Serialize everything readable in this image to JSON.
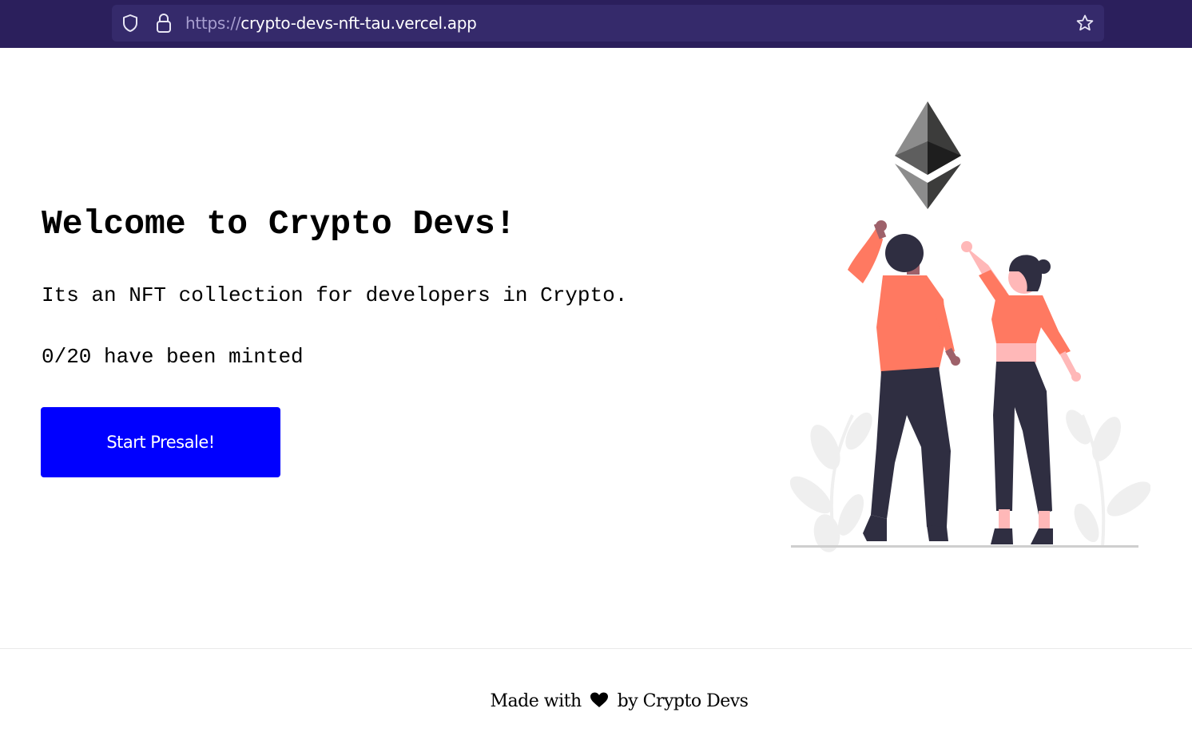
{
  "browser": {
    "url_protocol": "https://",
    "url_host": "crypto-devs-nft-tau.vercel.app",
    "icons": [
      "shield-icon",
      "lock-icon",
      "star-icon"
    ]
  },
  "hero": {
    "title": "Welcome to Crypto Devs!",
    "description": "Its an NFT collection for developers in Crypto.",
    "minted_status": "0/20 have been minted",
    "button_label": "Start Presale!"
  },
  "footer": {
    "text_before": "Made with",
    "text_after": "by Crypto Devs",
    "icon": "heart-icon"
  },
  "colors": {
    "browser_bar": "#2b1f5c",
    "button": "#0000ff",
    "accent_orange": "#ff7961",
    "dark_figure": "#2f2e41"
  }
}
